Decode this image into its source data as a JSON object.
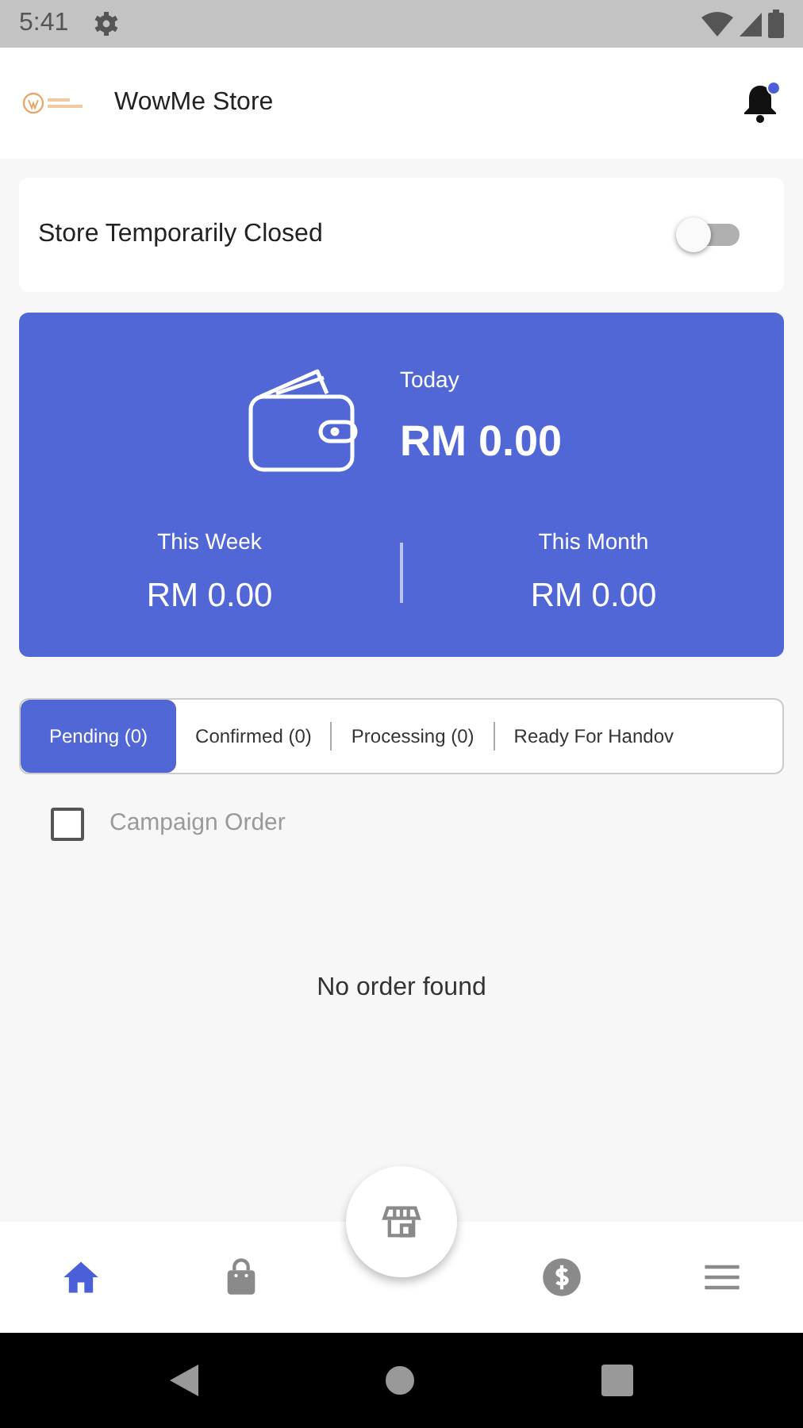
{
  "status_bar": {
    "time": "5:41"
  },
  "app_bar": {
    "title": "WowMe Store",
    "notification_unread": true
  },
  "store_toggle": {
    "label": "Store Temporarily Closed",
    "on": false
  },
  "earnings": {
    "today_label": "Today",
    "today_value": "RM 0.00",
    "periods": [
      {
        "label": "This Week",
        "value": "RM 0.00"
      },
      {
        "label": "This Month",
        "value": "RM 0.00"
      }
    ]
  },
  "tabs": [
    {
      "label": "Pending (0)",
      "selected": true
    },
    {
      "label": "Confirmed (0)",
      "selected": false
    },
    {
      "label": "Processing (0)",
      "selected": false
    },
    {
      "label": "Ready For Handov",
      "selected": false
    }
  ],
  "filter": {
    "label": "Campaign Order",
    "checked": false
  },
  "empty_message": "No order found",
  "bottom_nav": [
    {
      "kind": "home",
      "selected": true
    },
    {
      "kind": "bag",
      "selected": false
    },
    {
      "kind": "store",
      "selected": false
    },
    {
      "kind": "dollar",
      "selected": false
    },
    {
      "kind": "menu",
      "selected": false
    }
  ]
}
